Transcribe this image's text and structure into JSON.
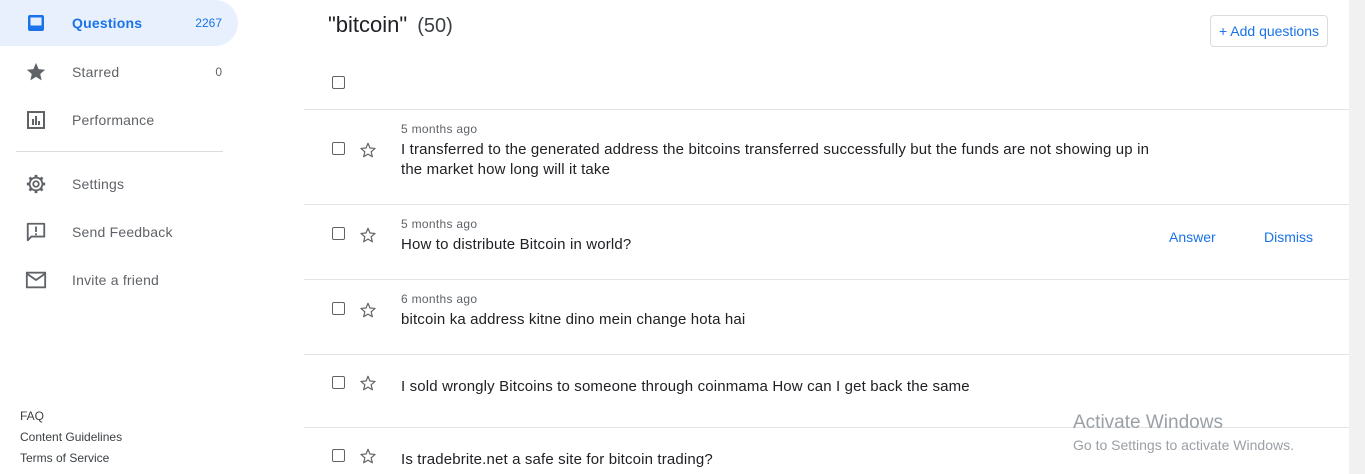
{
  "sidebar": {
    "items": [
      {
        "label": "Questions",
        "count": "2267",
        "icon": "inbox-icon"
      },
      {
        "label": "Starred",
        "count": "0",
        "icon": "star-icon"
      },
      {
        "label": "Performance",
        "icon": "bar-chart-icon"
      },
      {
        "label": "Settings",
        "icon": "gear-icon"
      },
      {
        "label": "Send Feedback",
        "icon": "feedback-icon"
      },
      {
        "label": "Invite a friend",
        "icon": "mail-icon"
      }
    ],
    "footer": [
      "FAQ",
      "Content Guidelines",
      "Terms of Service"
    ]
  },
  "main": {
    "title": "\"bitcoin\"",
    "count": "(50)",
    "add_button": "+ Add questions",
    "questions": [
      {
        "time": "5 months ago",
        "text": "I transferred to the generated address the bitcoins transferred successfully but the funds are not showing up in the market how long will it take"
      },
      {
        "time": "5 months ago",
        "text": "How to distribute Bitcoin in world?",
        "answer": "Answer",
        "dismiss": "Dismiss"
      },
      {
        "time": "6 months ago",
        "text": "bitcoin ka address kitne dino mein change hota hai"
      },
      {
        "time": "",
        "text": "I sold wrongly Bitcoins to someone through coinmama How can I get back the same"
      },
      {
        "time": "",
        "text": "Is tradebrite.net a safe site for bitcoin trading?"
      }
    ]
  },
  "watermark": {
    "title": "Activate Windows",
    "subtitle": "Go to Settings to activate Windows."
  },
  "colors": {
    "accent": "#1a73e8",
    "active_bg": "#e8f0fe"
  }
}
